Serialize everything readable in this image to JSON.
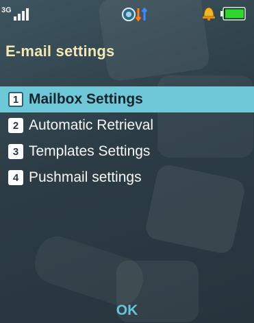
{
  "status_bar": {
    "network_label": "3G",
    "icons": [
      "signal-icon",
      "call-divert-icon",
      "data-transfer-icon",
      "alarm-icon",
      "battery-icon"
    ]
  },
  "screen": {
    "title": "E-mail settings"
  },
  "menu": {
    "items": [
      {
        "number": "1",
        "label": "Mailbox Settings",
        "selected": true
      },
      {
        "number": "2",
        "label": "Automatic Retrieval",
        "selected": false
      },
      {
        "number": "3",
        "label": "Templates Settings",
        "selected": false
      },
      {
        "number": "4",
        "label": "Pushmail settings",
        "selected": false
      }
    ]
  },
  "softkeys": {
    "center": "OK"
  },
  "colors": {
    "title": "#f1e8b4",
    "selection": "#6fc8d7",
    "softkey": "#63c6de",
    "battery": "#2fd630",
    "alarm": "#f0b72a"
  }
}
